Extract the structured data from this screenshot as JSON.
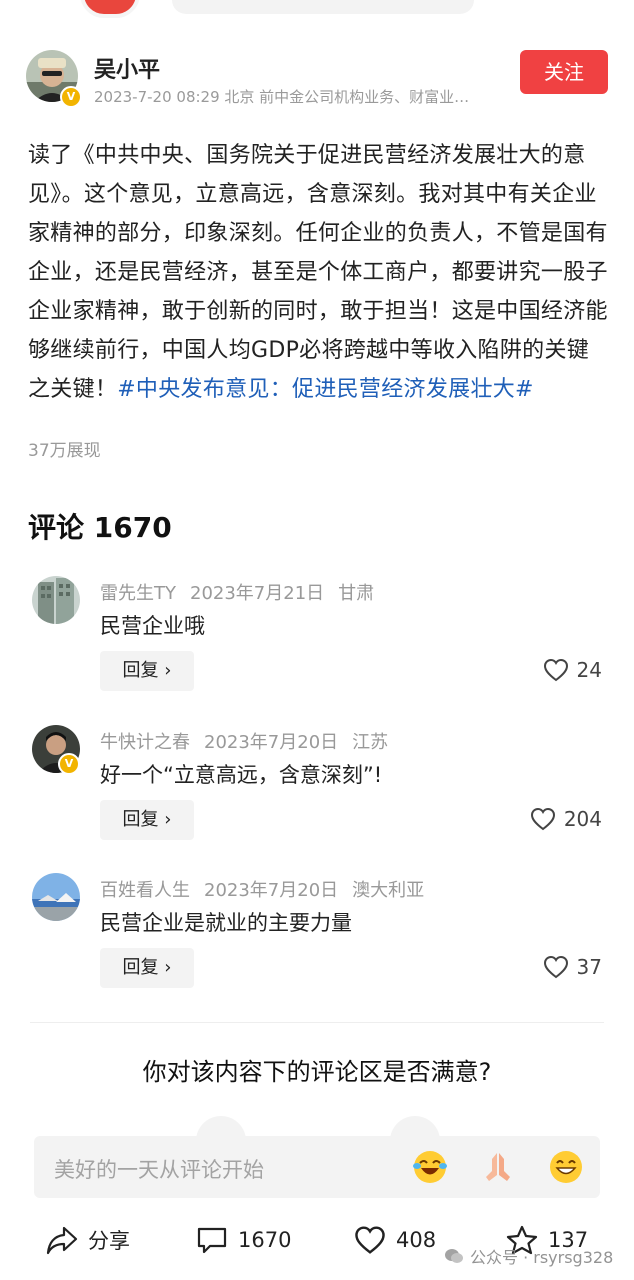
{
  "post": {
    "author": "吴小平",
    "meta": "2023-7-20 08:29 北京 前中金公司机构业务、财富业…",
    "follow_label": "关注",
    "text_main": "读了《中共中央、国务院关于促进民营经济发展壮大的意见》。这个意见，立意高远，含意深刻。我对其中有关企业家精神的部分，印象深刻。任何企业的负责人，不管是国有企业，还是民营经济，甚至是个体工商户，都要讲究一股子企业家精神，敢于创新的同时，敢于担当！这是中国经济能够继续前行，中国人均GDP必将跨越中等收入陷阱的关键之关键！",
    "hashtag": "#中央发布意见：促进民营经济发展壮大#",
    "views": "37万展现",
    "verified_badge": "V"
  },
  "comments_section": {
    "title": "评论 1670",
    "items": [
      {
        "user": "雷先生TY",
        "date": "2023年7月21日",
        "location": "甘肃",
        "text": "民营企业哦",
        "reply_label": "回复 ›",
        "likes": "24",
        "avatar_icon": "building-avatar-icon"
      },
      {
        "user": "牛快计之春",
        "date": "2023年7月20日",
        "location": "江苏",
        "text": "好一个“立意高远，含意深刻”!",
        "reply_label": "回复 ›",
        "likes": "204",
        "avatar_icon": "person-avatar-icon",
        "verified_badge": "V"
      },
      {
        "user": "百姓看人生",
        "date": "2023年7月20日",
        "location": "澳大利亚",
        "text": "民营企业是就业的主要力量",
        "reply_label": "回复 ›",
        "likes": "37",
        "avatar_icon": "landscape-avatar-icon"
      }
    ]
  },
  "survey": {
    "question": "你对该内容下的评论区是否满意?"
  },
  "input_bar": {
    "placeholder": "美好的一天从评论开始",
    "emojis": [
      "laughing-crying-emoji",
      "praying-hands-emoji",
      "grinning-emoji"
    ]
  },
  "bottom_bar": {
    "share_label": "分享",
    "comment_count": "1670",
    "like_count": "408",
    "favorite_count": "137"
  },
  "watermark": {
    "text": "公众号 · rsyrsg328",
    "icon": "wechat-icon"
  },
  "colors": {
    "accent_red": "#f04142",
    "hashtag_blue": "#1f5fb8",
    "meta_gray": "#999999",
    "verified_gold": "#f2b400"
  }
}
